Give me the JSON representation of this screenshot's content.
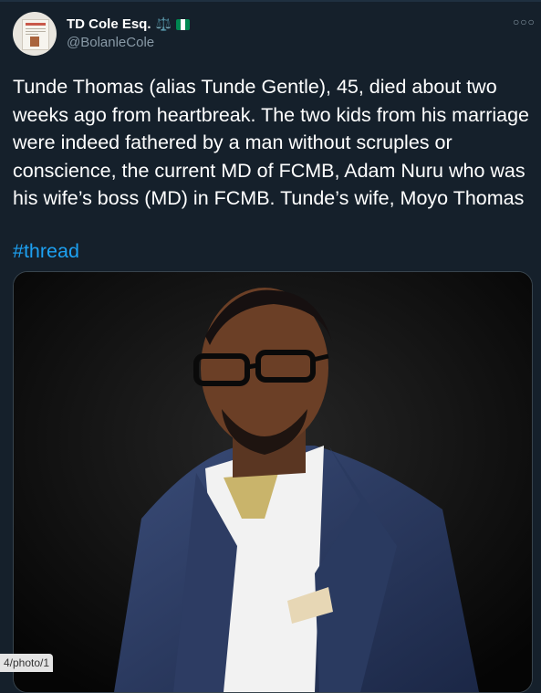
{
  "tweet": {
    "author_name": "TD Cole Esq.",
    "name_emoji": "⚖️",
    "handle": "@BolanleCole",
    "more_icon": "more-dots-icon",
    "text": "Tunde Thomas (alias Tunde Gentle), 45, died about two weeks ago from heartbreak. The two kids from his marriage were indeed fathered by a man without scruples or conscience, the current MD of FCMB, Adam Nuru who was his wife’s boss (MD) in FCMB. Tunde’s wife, Moyo Thomas",
    "hashtag": "#thread",
    "flag_colors": [
      "#008751",
      "#ffffff",
      "#008751"
    ]
  },
  "colors": {
    "background": "#15202b",
    "text": "#ffffff",
    "secondary": "#8899a6",
    "link": "#1da1f2"
  },
  "status_bar": {
    "url_fragment": "4/photo/1"
  }
}
